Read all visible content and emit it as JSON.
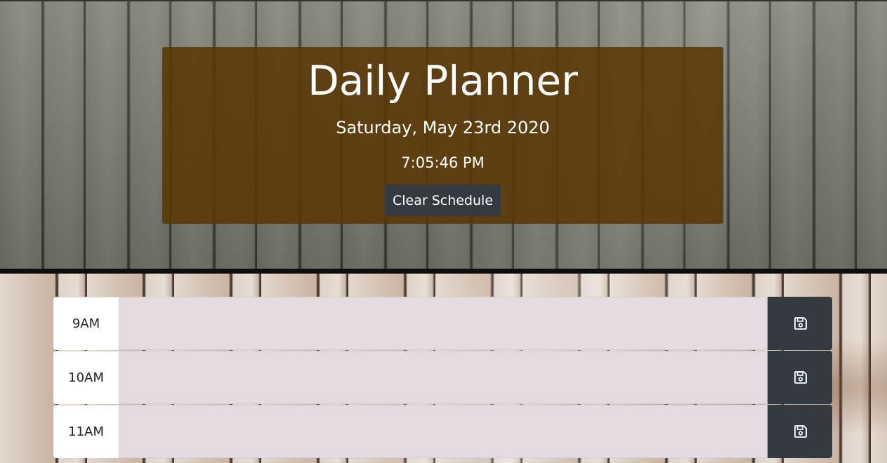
{
  "header": {
    "title": "Daily Planner",
    "date": "Saturday, May 23rd 2020",
    "time": "7:05:46 PM",
    "clear_button_label": "Clear Schedule"
  },
  "schedule": {
    "rows": [
      {
        "hour": "9AM",
        "text": "",
        "save_icon": "floppy-disk-icon"
      },
      {
        "hour": "10AM",
        "text": "",
        "save_icon": "floppy-disk-icon"
      },
      {
        "hour": "11AM",
        "text": "",
        "save_icon": "floppy-disk-icon"
      }
    ]
  },
  "colors": {
    "jumbotron_bg": "#5a3705",
    "button_bg": "#343a40",
    "textarea_bg": "#e3dbe1",
    "hour_bg": "#ffffff"
  }
}
